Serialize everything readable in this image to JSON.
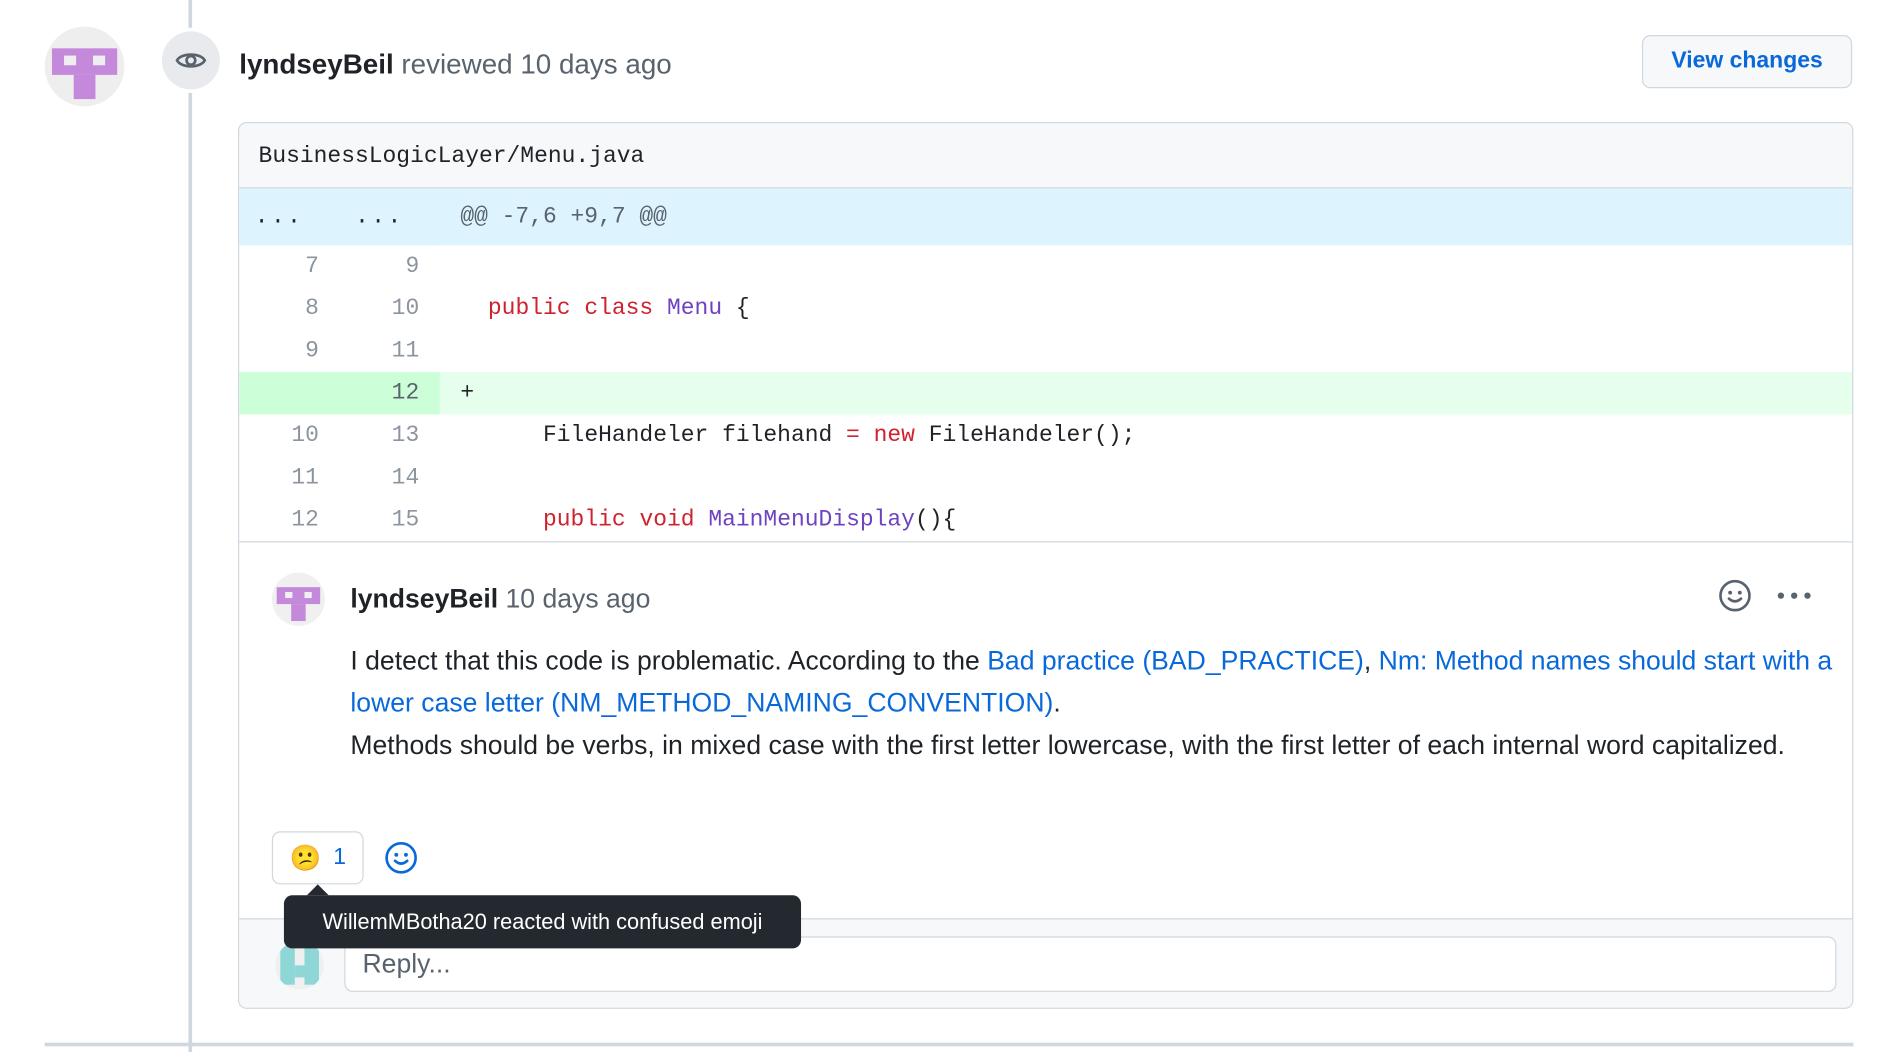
{
  "colors": {
    "link": "#0969da",
    "keyword": "#cf222e",
    "entity": "#6f42c1",
    "added_row_bg": "#e6ffec",
    "hunk_bg": "#ddf4ff",
    "tooltip_bg": "#24292f",
    "identicon_purple": "#c589db",
    "identicon_teal": "#8fd6d6"
  },
  "review": {
    "author": "lyndseyBeil",
    "action": "reviewed",
    "time": "10 days ago",
    "badge_icon": "eye-icon",
    "view_changes_label": "View changes"
  },
  "file": {
    "path": "BusinessLogicLayer/Menu.java"
  },
  "diff": {
    "hunk": {
      "old": "...",
      "new": "...",
      "text": "@@ -7,6 +9,7 @@"
    },
    "lines": [
      {
        "old": "7",
        "new": "9",
        "marker": "",
        "indent": "",
        "tokens": []
      },
      {
        "old": "8",
        "new": "10",
        "marker": "",
        "indent": "  ",
        "tokens": [
          [
            "kw",
            "public"
          ],
          [
            "t",
            " "
          ],
          [
            "kw",
            "class"
          ],
          [
            "t",
            " "
          ],
          [
            "ent",
            "Menu"
          ],
          [
            "t",
            " {"
          ]
        ]
      },
      {
        "old": "9",
        "new": "11",
        "marker": "",
        "indent": "",
        "tokens": []
      },
      {
        "old": "",
        "new": "12",
        "marker": "+",
        "indent": "",
        "tokens": []
      },
      {
        "old": "10",
        "new": "13",
        "marker": "",
        "indent": "      ",
        "tokens": [
          [
            "t",
            "FileHandeler filehand "
          ],
          [
            "kw",
            "="
          ],
          [
            "t",
            " "
          ],
          [
            "kw",
            "new"
          ],
          [
            "t",
            " FileHandeler();"
          ]
        ]
      },
      {
        "old": "11",
        "new": "14",
        "marker": "",
        "indent": "",
        "tokens": []
      },
      {
        "old": "12",
        "new": "15",
        "marker": "",
        "indent": "      ",
        "tokens": [
          [
            "kw",
            "public"
          ],
          [
            "t",
            " "
          ],
          [
            "kw",
            "void"
          ],
          [
            "t",
            " "
          ],
          [
            "ent",
            "MainMenuDisplay"
          ],
          [
            "t",
            "(){"
          ]
        ]
      }
    ]
  },
  "comment": {
    "author": "lyndseyBeil",
    "time": "10 days ago",
    "text_intro": "I detect that this code is problematic. According to the ",
    "link1": "Bad practice (BAD_PRACTICE)",
    "separator": ", ",
    "link2": "Nm: Method names should start with a lower case letter (NM_METHOD_NAMING_CONVENTION)",
    "text_period": ".",
    "text_second": "Methods should be verbs, in mixed case with the first letter lowercase, with the first letter of each internal word capitalized.",
    "icons": [
      "smiley-icon",
      "kebab-horizontal-icon"
    ]
  },
  "reactions": {
    "emoji": "😕",
    "count": "1",
    "add_icon": "smiley-icon",
    "tooltip": "WillemMBotha20 reacted with confused emoji"
  },
  "reply": {
    "placeholder": "Reply..."
  }
}
